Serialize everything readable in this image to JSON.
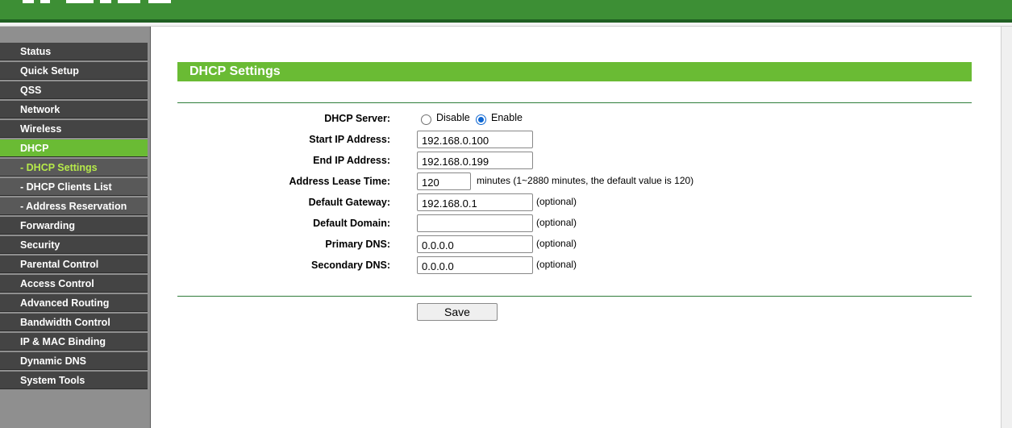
{
  "brand": {
    "color": "#3d8f35",
    "accent": "#6abb34"
  },
  "nav": [
    {
      "label": "Status",
      "type": "main"
    },
    {
      "label": "Quick Setup",
      "type": "main"
    },
    {
      "label": "QSS",
      "type": "main"
    },
    {
      "label": "Network",
      "type": "main"
    },
    {
      "label": "Wireless",
      "type": "main"
    },
    {
      "label": "DHCP",
      "type": "main",
      "active": true
    },
    {
      "label": "- DHCP Settings",
      "type": "sub",
      "current": true
    },
    {
      "label": "- DHCP Clients List",
      "type": "sub"
    },
    {
      "label": "- Address Reservation",
      "type": "sub"
    },
    {
      "label": "Forwarding",
      "type": "main"
    },
    {
      "label": "Security",
      "type": "main"
    },
    {
      "label": "Parental Control",
      "type": "main"
    },
    {
      "label": "Access Control",
      "type": "main"
    },
    {
      "label": "Advanced Routing",
      "type": "main"
    },
    {
      "label": "Bandwidth Control",
      "type": "main"
    },
    {
      "label": "IP & MAC Binding",
      "type": "main"
    },
    {
      "label": "Dynamic DNS",
      "type": "main"
    },
    {
      "label": "System Tools",
      "type": "main"
    }
  ],
  "page": {
    "title": "DHCP Settings"
  },
  "form": {
    "dhcp_server": {
      "label": "DHCP Server:",
      "options": [
        "Disable",
        "Enable"
      ],
      "selected": "Enable"
    },
    "start_ip": {
      "label": "Start IP Address:",
      "value": "192.168.0.100"
    },
    "end_ip": {
      "label": "End IP Address:",
      "value": "192.168.0.199"
    },
    "lease_time": {
      "label": "Address Lease Time:",
      "value": "120",
      "hint": "minutes (1~2880 minutes, the default value is 120)"
    },
    "gateway": {
      "label": "Default Gateway:",
      "value": "192.168.0.1",
      "hint": "(optional)"
    },
    "domain": {
      "label": "Default Domain:",
      "value": "",
      "hint": "(optional)"
    },
    "primary_dns": {
      "label": "Primary DNS:",
      "value": "0.0.0.0",
      "hint": "(optional)"
    },
    "secondary_dns": {
      "label": "Secondary DNS:",
      "value": "0.0.0.0",
      "hint": "(optional)"
    }
  },
  "actions": {
    "save_label": "Save"
  }
}
